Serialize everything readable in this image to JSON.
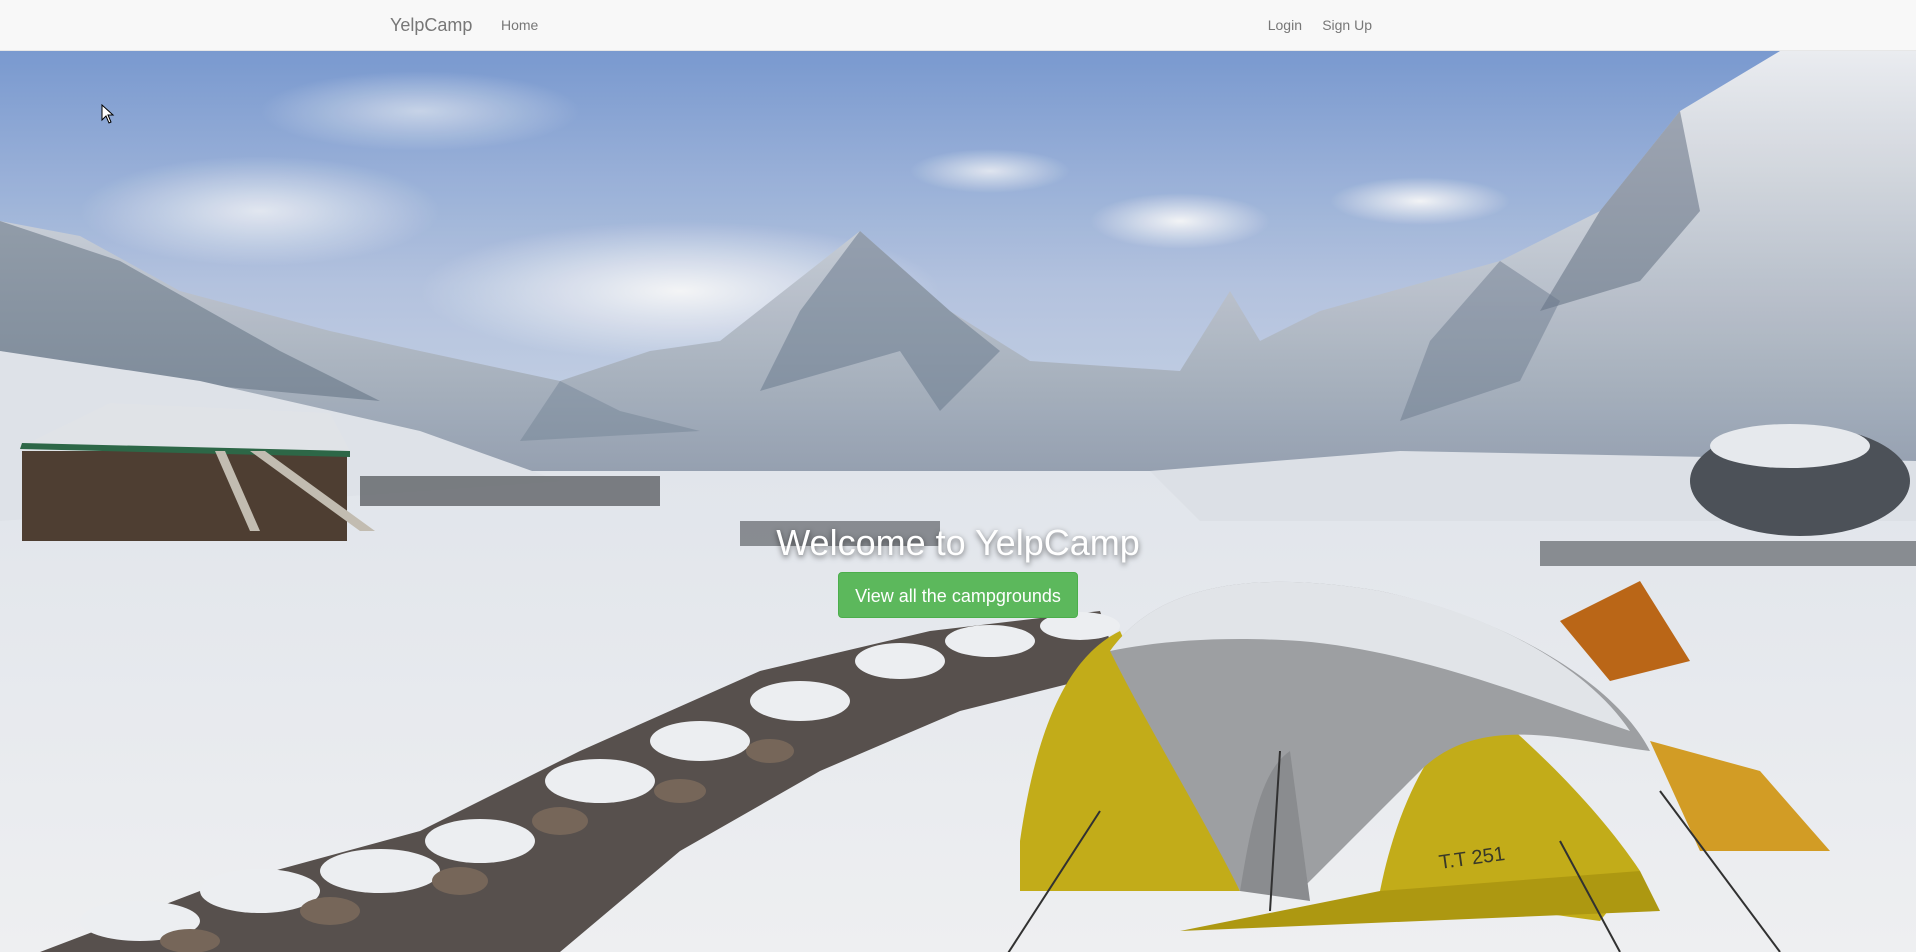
{
  "navbar": {
    "brand": "YelpCamp",
    "links": {
      "home": "Home",
      "login": "Login",
      "signup": "Sign Up"
    }
  },
  "hero": {
    "title": "Welcome to YelpCamp",
    "button_label": "View all the campgrounds",
    "tent_marking": "T.T 251"
  },
  "colors": {
    "navbar_bg": "#f8f8f8",
    "nav_text": "#777777",
    "button_green": "#5cb85c",
    "tent_yellow": "#c9b21a"
  }
}
